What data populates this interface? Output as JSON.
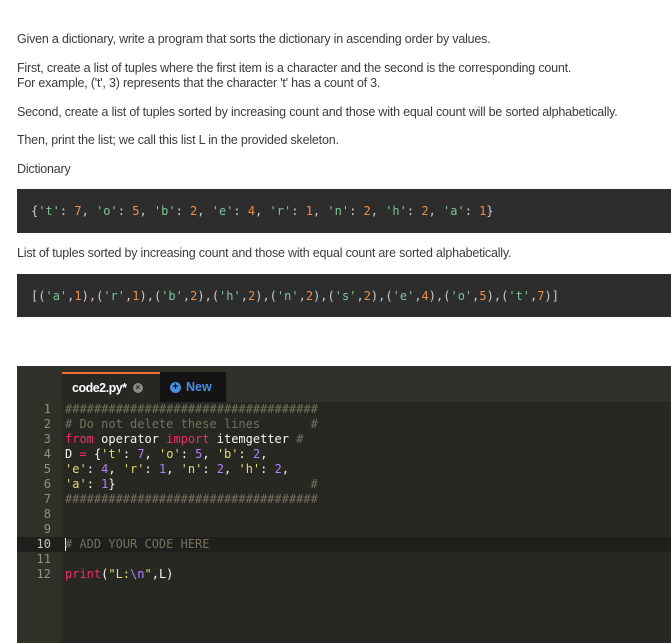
{
  "instructions": {
    "p1": "Given a dictionary, write a program that sorts the dictionary in ascending order by values.",
    "p2a": "First, create a list of tuples where the first item is a character and the second is the corresponding count.",
    "p2b": "For example, ('t', 3) represents that the character 't' has a count of 3.",
    "p3": "Second, create a list of tuples sorted by increasing count and those with equal count will be sorted alphabetically.",
    "p4": "Then, print the list; we call this list L in the provided skeleton.",
    "dictionary_label": "Dictionary",
    "list_label": "List of tuples sorted by increasing count and those with equal count are sorted alphabetically."
  },
  "dictionary": {
    "entries": [
      {
        "key": "'t'",
        "value": "7"
      },
      {
        "key": "'o'",
        "value": "5"
      },
      {
        "key": "'b'",
        "value": "2"
      },
      {
        "key": "'e'",
        "value": "4"
      },
      {
        "key": "'r'",
        "value": "1"
      },
      {
        "key": "'n'",
        "value": "2"
      },
      {
        "key": "'h'",
        "value": "2"
      },
      {
        "key": "'a'",
        "value": "1"
      }
    ]
  },
  "sorted_list": {
    "entries": [
      {
        "key": "'a'",
        "value": "1"
      },
      {
        "key": "'r'",
        "value": "1"
      },
      {
        "key": "'b'",
        "value": "2"
      },
      {
        "key": "'h'",
        "value": "2"
      },
      {
        "key": "'n'",
        "value": "2"
      },
      {
        "key": "'s'",
        "value": "2"
      },
      {
        "key": "'e'",
        "value": "4"
      },
      {
        "key": "'o'",
        "value": "5"
      },
      {
        "key": "'t'",
        "value": "7"
      }
    ]
  },
  "editor": {
    "tabs": [
      {
        "label": "code2.py*",
        "close_icon": "close-circle-icon",
        "active": true
      },
      {
        "label": "New",
        "icon": "plus-circle-icon"
      }
    ],
    "active_line": 10,
    "lines": [
      {
        "num": "1",
        "hash_line": "###################################"
      },
      {
        "num": "2",
        "comment": "# Do not delete these lines",
        "tail": "#"
      },
      {
        "num": "3",
        "kw1": "from",
        "mod": "operator",
        "kw2": "import",
        "name": "itemgetter",
        "tail": "#"
      },
      {
        "num": "4",
        "text": "D = {'t': 7, 'o': 5, 'b': 2,"
      },
      {
        "num": "5",
        "text": "'e': 4, 'r': 1, 'n': 2, 'h': 2,"
      },
      {
        "num": "6",
        "text": "'a': 1}",
        "tail": "#"
      },
      {
        "num": "7",
        "hash_line": "###################################"
      },
      {
        "num": "8"
      },
      {
        "num": "9"
      },
      {
        "num": "10",
        "comment": "# ADD YOUR CODE HERE"
      },
      {
        "num": "11"
      },
      {
        "num": "12",
        "fn": "print",
        "str": "\"L:\\n\"",
        "arg": "L"
      }
    ]
  }
}
